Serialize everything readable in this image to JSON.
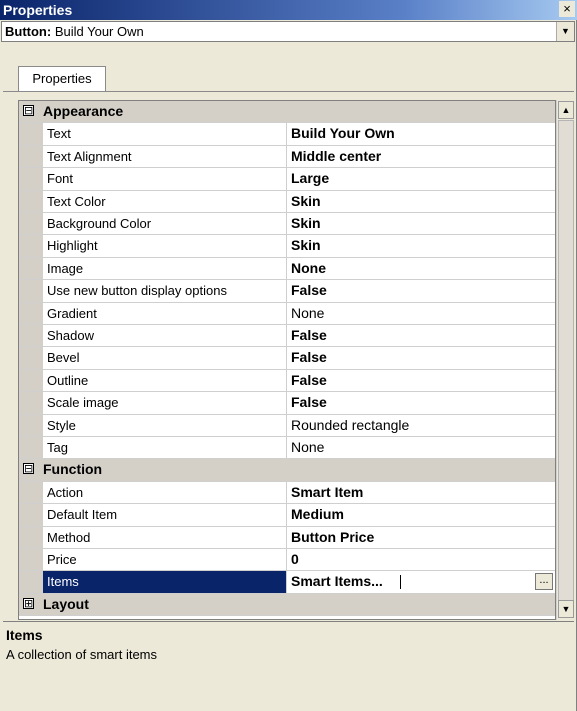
{
  "window": {
    "title": "Properties",
    "close_glyph": "×"
  },
  "object_selector": {
    "type_label": "Button:",
    "value": "Build Your Own",
    "arrow_icon": "dropdown-arrow-icon"
  },
  "tabs": [
    {
      "label": "Properties"
    }
  ],
  "grid": {
    "categories": [
      {
        "name": "Appearance",
        "expanded": true,
        "toggle": "⊟",
        "properties": [
          {
            "name": "Text",
            "value": "Build Your Own",
            "bold": true
          },
          {
            "name": "Text Alignment",
            "value": "Middle center",
            "bold": true
          },
          {
            "name": "Font",
            "value": "Large",
            "bold": true
          },
          {
            "name": "Text Color",
            "value": "Skin",
            "bold": true
          },
          {
            "name": "Background Color",
            "value": "Skin",
            "bold": true
          },
          {
            "name": "Highlight",
            "value": "Skin",
            "bold": true
          },
          {
            "name": "Image",
            "value": "None",
            "bold": true
          },
          {
            "name": "Use new button display options",
            "value": "False",
            "bold": true
          },
          {
            "name": "Gradient",
            "value": "None",
            "bold": false
          },
          {
            "name": "Shadow",
            "value": "False",
            "bold": true
          },
          {
            "name": "Bevel",
            "value": "False",
            "bold": true
          },
          {
            "name": "Outline",
            "value": "False",
            "bold": true
          },
          {
            "name": "Scale image",
            "value": "False",
            "bold": true
          },
          {
            "name": "Style",
            "value": "Rounded rectangle",
            "bold": false
          },
          {
            "name": "Tag",
            "value": "None",
            "bold": false
          }
        ]
      },
      {
        "name": "Function",
        "expanded": true,
        "toggle": "⊟",
        "properties": [
          {
            "name": "Action",
            "value": "Smart Item",
            "bold": true
          },
          {
            "name": "Default Item",
            "value": "Medium",
            "bold": true
          },
          {
            "name": "Method",
            "value": "Button Price",
            "bold": true
          },
          {
            "name": "Price",
            "value": "0",
            "bold": true
          },
          {
            "name": "Items",
            "value": "Smart Items...",
            "bold": true,
            "selected": true,
            "has_ellipsis": true
          }
        ]
      },
      {
        "name": "Layout",
        "expanded": false,
        "toggle": "⊞",
        "properties": []
      }
    ],
    "ellipsis_label": "..."
  },
  "scrollbar": {
    "up_glyph": "▲",
    "down_glyph": "▼"
  },
  "description": {
    "title": "Items",
    "text": "A collection of smart items"
  },
  "colors": {
    "titlebar": "#0a246a",
    "selection": "#0a246a",
    "face": "#ece9d8"
  }
}
